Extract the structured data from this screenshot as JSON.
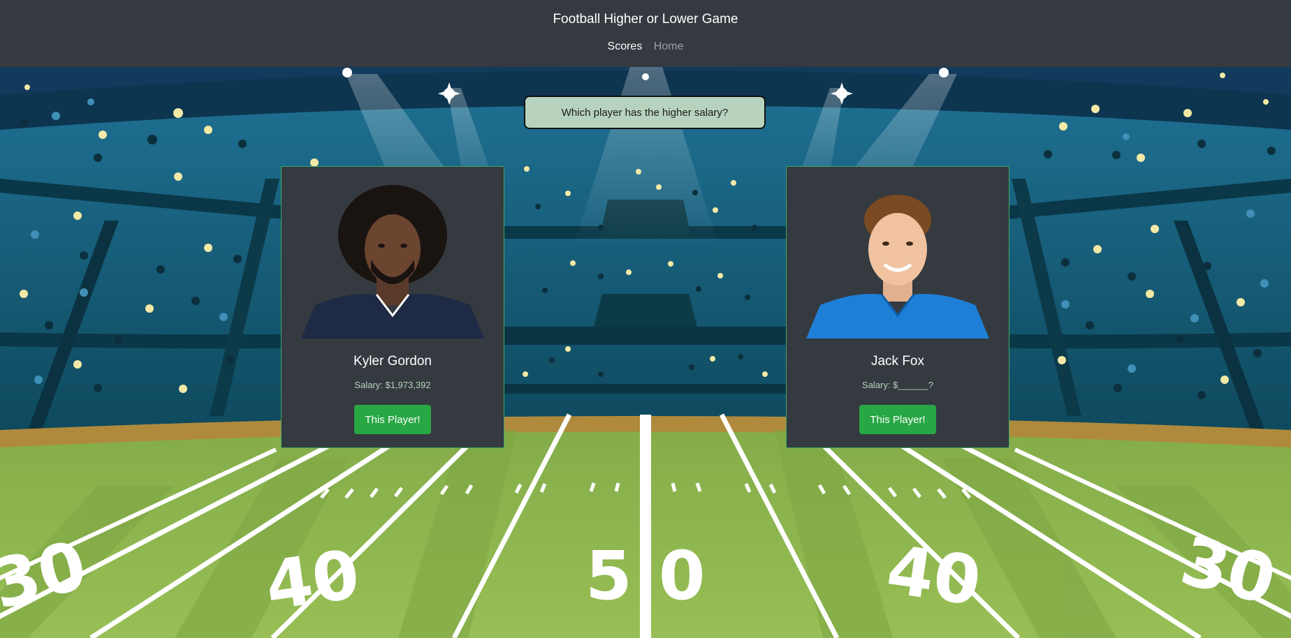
{
  "navbar": {
    "title": "Football Higher or Lower Game",
    "links": {
      "scores": "Scores",
      "home": "Home"
    }
  },
  "prompt": {
    "question": "Which player has the higher salary?"
  },
  "players": [
    {
      "name": "Kyler Gordon",
      "salary_text": "Salary: $1,973,392",
      "button_label": "This Player!",
      "jersey_color": "#1f2a44"
    },
    {
      "name": "Jack Fox",
      "salary_text": "Salary: $______?",
      "button_label": "This Player!",
      "jersey_color": "#1e7fd6"
    }
  ],
  "field": {
    "yard_numbers": [
      "30",
      "40",
      "50",
      "40",
      "30"
    ]
  },
  "colors": {
    "navbar": "#343a40",
    "card": "#343a40",
    "button": "#28a745",
    "question_bg": "#b7d3bd"
  }
}
